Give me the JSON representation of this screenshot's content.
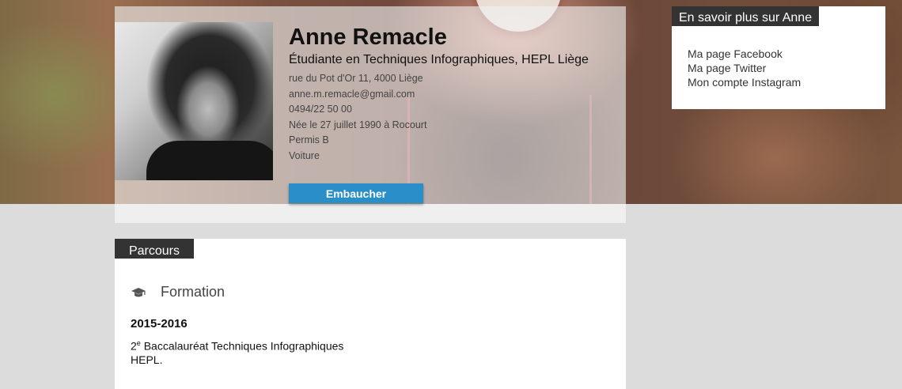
{
  "profile": {
    "name": "Anne Remacle",
    "subtitle": "Étudiante en Techniques Infographiques, HEPL Liège",
    "details": [
      "rue du Pot d'Or 11, 4000 Liège",
      "anne.m.remacle@gmail.com",
      "0494/22 50 00",
      "Née le 27 juillet 1990 à Rocourt",
      "Permis B",
      "Voiture"
    ],
    "hire_label": "Embaucher"
  },
  "sidebar": {
    "title": "En savoir plus sur Anne",
    "links": [
      "Ma page Facebook",
      "Ma page Twitter",
      "Mon compte Instagram"
    ]
  },
  "parcours": {
    "title": "Parcours",
    "section_title": "Formation",
    "section_icon": "graduation-cap-icon",
    "entries": [
      {
        "years": "2015-2016",
        "degree_number": "2",
        "degree_suffix": "e",
        "degree_rest": " Baccalauréat Techniques Infographiques",
        "school": "HEPL."
      }
    ]
  },
  "colors": {
    "button": "#2a8fc9",
    "tab_header": "#333333",
    "page_background": "#dcdcdc"
  }
}
